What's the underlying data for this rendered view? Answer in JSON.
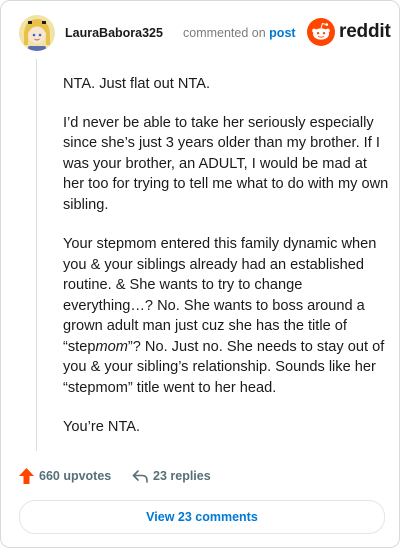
{
  "comment": {
    "username": "LauraBabora325",
    "action_text": "commented on",
    "post_link": "post",
    "paragraphs": [
      "NTA. Just flat out NTA.",
      "I’d never be able to take her seriously especially since she’s just 3 years older than my brother. If I was your brother, an ADULT, I would be mad at her too for trying to tell me what to do with my own sibling.",
      "Your stepmom entered this family dynamic when you & your siblings already had an established routine. & She wants to try to change everything…? No. She wants to boss around a grown adult man just cuz she has the title of “stepmom”? No. Just no. She needs to stay out of you & your sibling’s relationship. Sounds like her “stepmom” title went to her head.",
      "You’re NTA."
    ]
  },
  "brand": {
    "name": "reddit",
    "icon": "reddit-snoo-icon",
    "color": "#ff4500"
  },
  "actions": {
    "upvotes": "660 upvotes",
    "replies": "23 replies",
    "upvote_icon": "upvote-arrow-icon",
    "reply_icon": "reply-arrow-icon",
    "upvote_color": "#ff4500"
  },
  "view_button": {
    "label": "View 23 comments"
  }
}
